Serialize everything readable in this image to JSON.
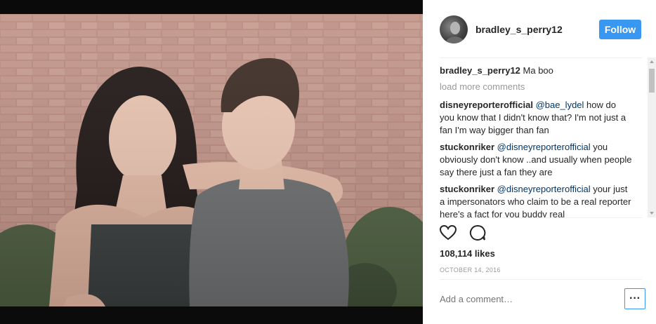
{
  "post": {
    "username": "bradley_s_perry12",
    "follow_label": "Follow",
    "caption_author": "bradley_s_perry12",
    "caption_text": " Ma boo",
    "load_more": "load more comments",
    "comments": [
      {
        "author": "disneyreporterofficial",
        "mention": "@bae_lydel",
        "text": " how do you know that I didn't know that? I'm not just a fan I'm way bigger than fan"
      },
      {
        "author": "stuckonriker",
        "mention": "@disneyreporterofficial",
        "text": " you obviously don't know ..and usually when people say there just a fan they are"
      },
      {
        "author": "stuckonriker",
        "mention": "@disneyreporterofficial",
        "text": " your just a impersonators who claim to be a real reporter here's a fact for you buddy real"
      }
    ],
    "likes": "108,114 likes",
    "date": "OCTOBER 14, 2016",
    "add_comment_placeholder": "Add a comment…",
    "more_label": "···",
    "icons": [
      "heart-icon",
      "comment-icon",
      "more-options-icon"
    ],
    "colors": {
      "follow_button": "#3897f0",
      "mention": "#003569",
      "muted": "#999999"
    }
  }
}
